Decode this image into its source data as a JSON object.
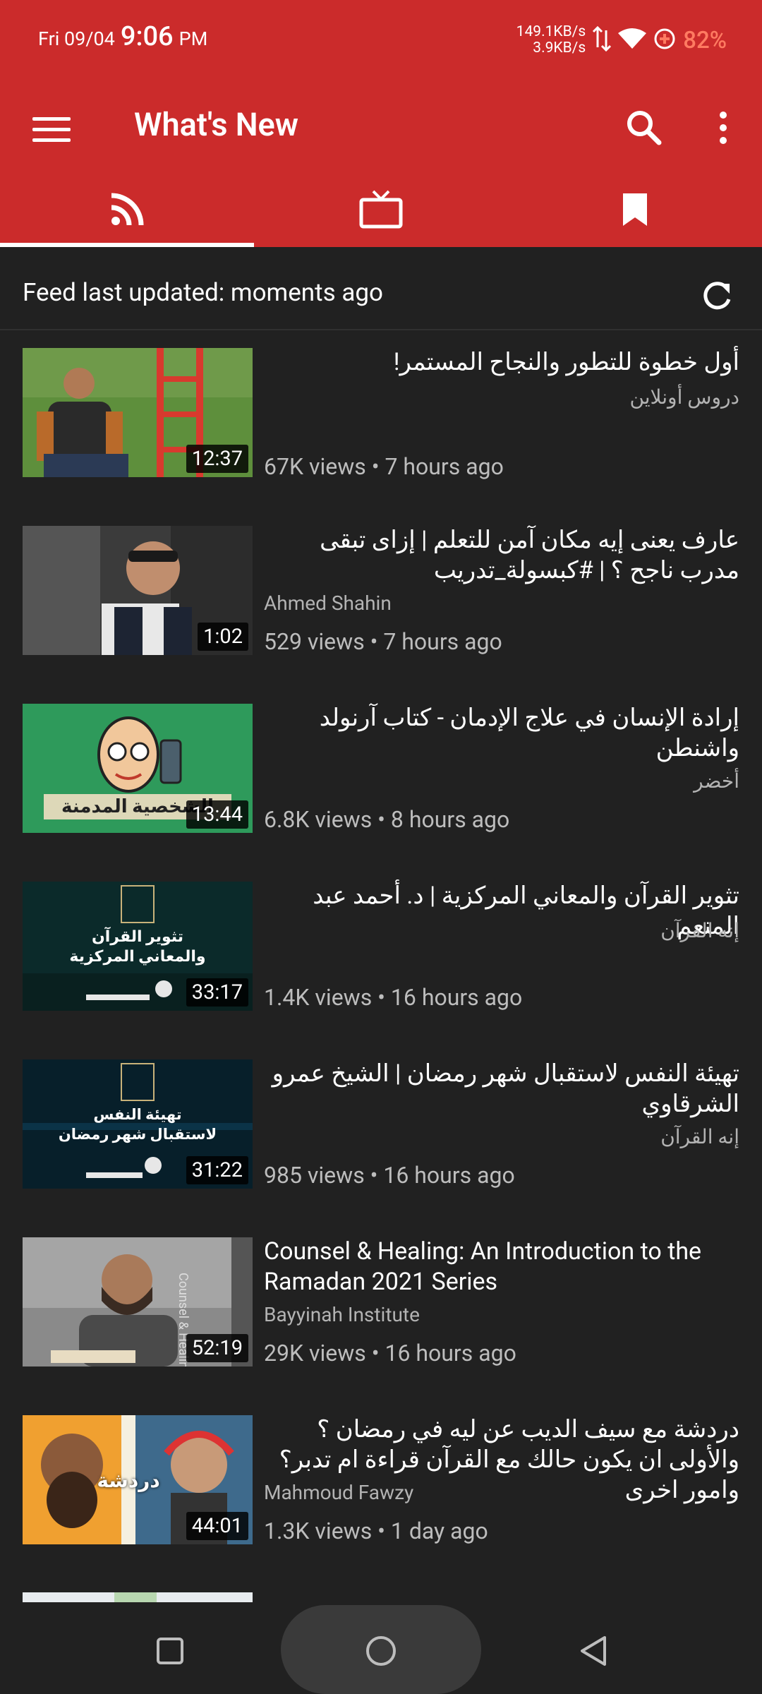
{
  "status_bar": {
    "date": "Fri 09/04",
    "time": "9:06",
    "ampm": "PM",
    "net_down": "149.1KB/s",
    "net_up": "3.9KB/s",
    "battery": "82%"
  },
  "app_bar": {
    "title": "What's New",
    "icons": [
      "menu-icon",
      "search-icon",
      "more-vert-icon"
    ]
  },
  "tabs": [
    {
      "icon": "rss-feed-icon",
      "active": true
    },
    {
      "icon": "tv-subscriptions-icon",
      "active": false
    },
    {
      "icon": "bookmark-icon",
      "active": false
    }
  ],
  "feed": {
    "status": "Feed last updated: moments ago",
    "refresh_icon": "refresh-icon"
  },
  "videos": [
    {
      "title": "أول خطوة للتطور والنجاح المستمر!",
      "channel": "دروس أونلاين",
      "meta": "67K views • 7 hours ago",
      "duration": "12:37",
      "rtl": true
    },
    {
      "title": "عارف يعنى إيه مكان آمن للتعلم | إزاى تبقى مدرب ناجح ؟ | #كبسولة_تدريب",
      "channel": "Ahmed Shahin",
      "meta": "529 views • 7 hours ago",
      "duration": "1:02",
      "rtl": true
    },
    {
      "title": "إرادة الإنسان في علاج الإدمان - كتاب آرنولد واشنطن",
      "channel": "أخضر",
      "meta": "6.8K views • 8 hours ago",
      "duration": "13:44",
      "rtl": true
    },
    {
      "title": "تثوير القرآن والمعاني المركزية | د. أحمد عبد المنعم",
      "channel": "إنه القرآن",
      "meta": "1.4K views • 16 hours ago",
      "duration": "33:17",
      "rtl": true
    },
    {
      "title": "تهيئة النفس لاستقبال شهر رمضان | الشيخ عمرو الشرقاوي",
      "channel": "إنه القرآن",
      "meta": "985 views • 16 hours ago",
      "duration": "31:22",
      "rtl": true
    },
    {
      "title": "Counsel & Healing: An Introduction to the Ramadan 2021 Series",
      "channel": "Bayyinah Institute",
      "meta": "29K views • 16 hours ago",
      "duration": "52:19",
      "rtl": false
    },
    {
      "title": "دردشة مع سيف الديب عن ليه في رمضان ؟ والأولى ان يكون حالك مع القرآن قراءة ام تدبر؟ وامور اخرى",
      "channel": "Mahmoud Fawzy",
      "meta": "1.3K views • 1 day ago",
      "duration": "44:01",
      "rtl": true
    }
  ],
  "thumb_text": {
    "v3": "الشخصية المدمنة",
    "v4_a": "تثوير القرآن",
    "v4_b": "والمعاني المركزية",
    "v5_a": "تهيئة النفس",
    "v5_b": "لاستقبال شهر رمضان",
    "v6": "Counsel & Healing",
    "v7": "دردشة"
  },
  "nav": {
    "icons": [
      "recents-square-icon",
      "home-circle-icon",
      "back-triangle-icon"
    ]
  },
  "colors": {
    "primary": "#cb2b2b",
    "background": "#212121",
    "battery_text": "#ff7b61"
  }
}
